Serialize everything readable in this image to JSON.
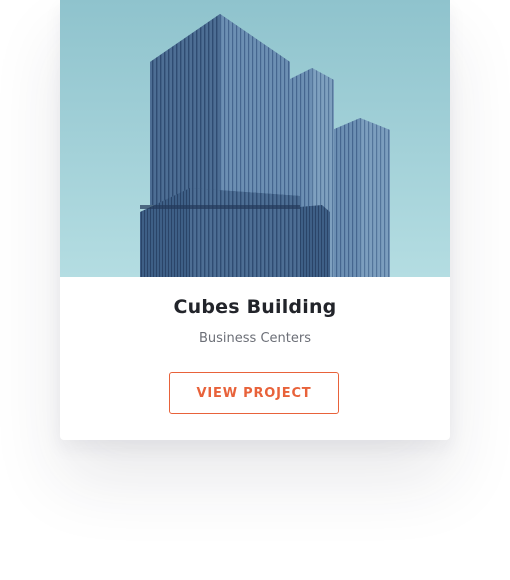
{
  "card": {
    "image_subject": "building-photo",
    "title": "Cubes Building",
    "subtitle": "Business Centers",
    "button_label": "VIEW PROJECT"
  },
  "colors": {
    "accent": "#e8623a",
    "sky": "#9fd0d8",
    "title": "#22242a",
    "subtitle": "#6c6f77"
  }
}
